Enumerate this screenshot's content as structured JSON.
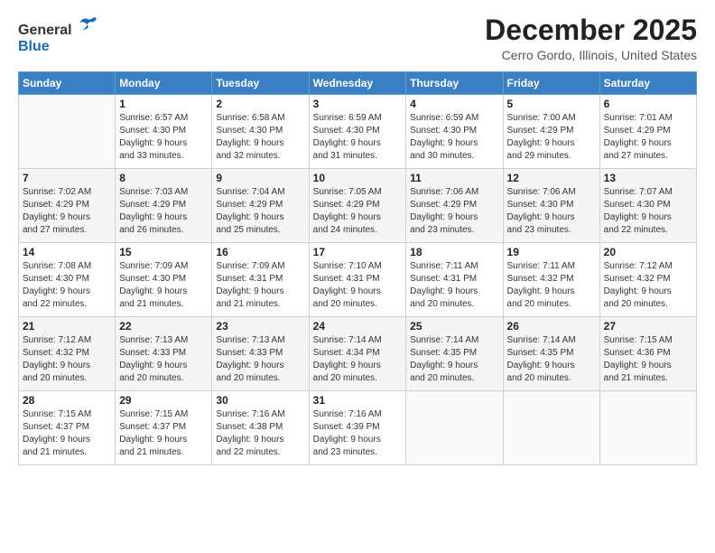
{
  "header": {
    "logo_general": "General",
    "logo_blue": "Blue",
    "title": "December 2025",
    "subtitle": "Cerro Gordo, Illinois, United States"
  },
  "days_of_week": [
    "Sunday",
    "Monday",
    "Tuesday",
    "Wednesday",
    "Thursday",
    "Friday",
    "Saturday"
  ],
  "weeks": [
    [
      {
        "day": "",
        "info": ""
      },
      {
        "day": "1",
        "info": "Sunrise: 6:57 AM\nSunset: 4:30 PM\nDaylight: 9 hours\nand 33 minutes."
      },
      {
        "day": "2",
        "info": "Sunrise: 6:58 AM\nSunset: 4:30 PM\nDaylight: 9 hours\nand 32 minutes."
      },
      {
        "day": "3",
        "info": "Sunrise: 6:59 AM\nSunset: 4:30 PM\nDaylight: 9 hours\nand 31 minutes."
      },
      {
        "day": "4",
        "info": "Sunrise: 6:59 AM\nSunset: 4:30 PM\nDaylight: 9 hours\nand 30 minutes."
      },
      {
        "day": "5",
        "info": "Sunrise: 7:00 AM\nSunset: 4:29 PM\nDaylight: 9 hours\nand 29 minutes."
      },
      {
        "day": "6",
        "info": "Sunrise: 7:01 AM\nSunset: 4:29 PM\nDaylight: 9 hours\nand 27 minutes."
      }
    ],
    [
      {
        "day": "7",
        "info": "Sunrise: 7:02 AM\nSunset: 4:29 PM\nDaylight: 9 hours\nand 27 minutes."
      },
      {
        "day": "8",
        "info": "Sunrise: 7:03 AM\nSunset: 4:29 PM\nDaylight: 9 hours\nand 26 minutes."
      },
      {
        "day": "9",
        "info": "Sunrise: 7:04 AM\nSunset: 4:29 PM\nDaylight: 9 hours\nand 25 minutes."
      },
      {
        "day": "10",
        "info": "Sunrise: 7:05 AM\nSunset: 4:29 PM\nDaylight: 9 hours\nand 24 minutes."
      },
      {
        "day": "11",
        "info": "Sunrise: 7:06 AM\nSunset: 4:29 PM\nDaylight: 9 hours\nand 23 minutes."
      },
      {
        "day": "12",
        "info": "Sunrise: 7:06 AM\nSunset: 4:30 PM\nDaylight: 9 hours\nand 23 minutes."
      },
      {
        "day": "13",
        "info": "Sunrise: 7:07 AM\nSunset: 4:30 PM\nDaylight: 9 hours\nand 22 minutes."
      }
    ],
    [
      {
        "day": "14",
        "info": "Sunrise: 7:08 AM\nSunset: 4:30 PM\nDaylight: 9 hours\nand 22 minutes."
      },
      {
        "day": "15",
        "info": "Sunrise: 7:09 AM\nSunset: 4:30 PM\nDaylight: 9 hours\nand 21 minutes."
      },
      {
        "day": "16",
        "info": "Sunrise: 7:09 AM\nSunset: 4:31 PM\nDaylight: 9 hours\nand 21 minutes."
      },
      {
        "day": "17",
        "info": "Sunrise: 7:10 AM\nSunset: 4:31 PM\nDaylight: 9 hours\nand 20 minutes."
      },
      {
        "day": "18",
        "info": "Sunrise: 7:11 AM\nSunset: 4:31 PM\nDaylight: 9 hours\nand 20 minutes."
      },
      {
        "day": "19",
        "info": "Sunrise: 7:11 AM\nSunset: 4:32 PM\nDaylight: 9 hours\nand 20 minutes."
      },
      {
        "day": "20",
        "info": "Sunrise: 7:12 AM\nSunset: 4:32 PM\nDaylight: 9 hours\nand 20 minutes."
      }
    ],
    [
      {
        "day": "21",
        "info": "Sunrise: 7:12 AM\nSunset: 4:32 PM\nDaylight: 9 hours\nand 20 minutes."
      },
      {
        "day": "22",
        "info": "Sunrise: 7:13 AM\nSunset: 4:33 PM\nDaylight: 9 hours\nand 20 minutes."
      },
      {
        "day": "23",
        "info": "Sunrise: 7:13 AM\nSunset: 4:33 PM\nDaylight: 9 hours\nand 20 minutes."
      },
      {
        "day": "24",
        "info": "Sunrise: 7:14 AM\nSunset: 4:34 PM\nDaylight: 9 hours\nand 20 minutes."
      },
      {
        "day": "25",
        "info": "Sunrise: 7:14 AM\nSunset: 4:35 PM\nDaylight: 9 hours\nand 20 minutes."
      },
      {
        "day": "26",
        "info": "Sunrise: 7:14 AM\nSunset: 4:35 PM\nDaylight: 9 hours\nand 20 minutes."
      },
      {
        "day": "27",
        "info": "Sunrise: 7:15 AM\nSunset: 4:36 PM\nDaylight: 9 hours\nand 21 minutes."
      }
    ],
    [
      {
        "day": "28",
        "info": "Sunrise: 7:15 AM\nSunset: 4:37 PM\nDaylight: 9 hours\nand 21 minutes."
      },
      {
        "day": "29",
        "info": "Sunrise: 7:15 AM\nSunset: 4:37 PM\nDaylight: 9 hours\nand 21 minutes."
      },
      {
        "day": "30",
        "info": "Sunrise: 7:16 AM\nSunset: 4:38 PM\nDaylight: 9 hours\nand 22 minutes."
      },
      {
        "day": "31",
        "info": "Sunrise: 7:16 AM\nSunset: 4:39 PM\nDaylight: 9 hours\nand 23 minutes."
      },
      {
        "day": "",
        "info": ""
      },
      {
        "day": "",
        "info": ""
      },
      {
        "day": "",
        "info": ""
      }
    ]
  ]
}
